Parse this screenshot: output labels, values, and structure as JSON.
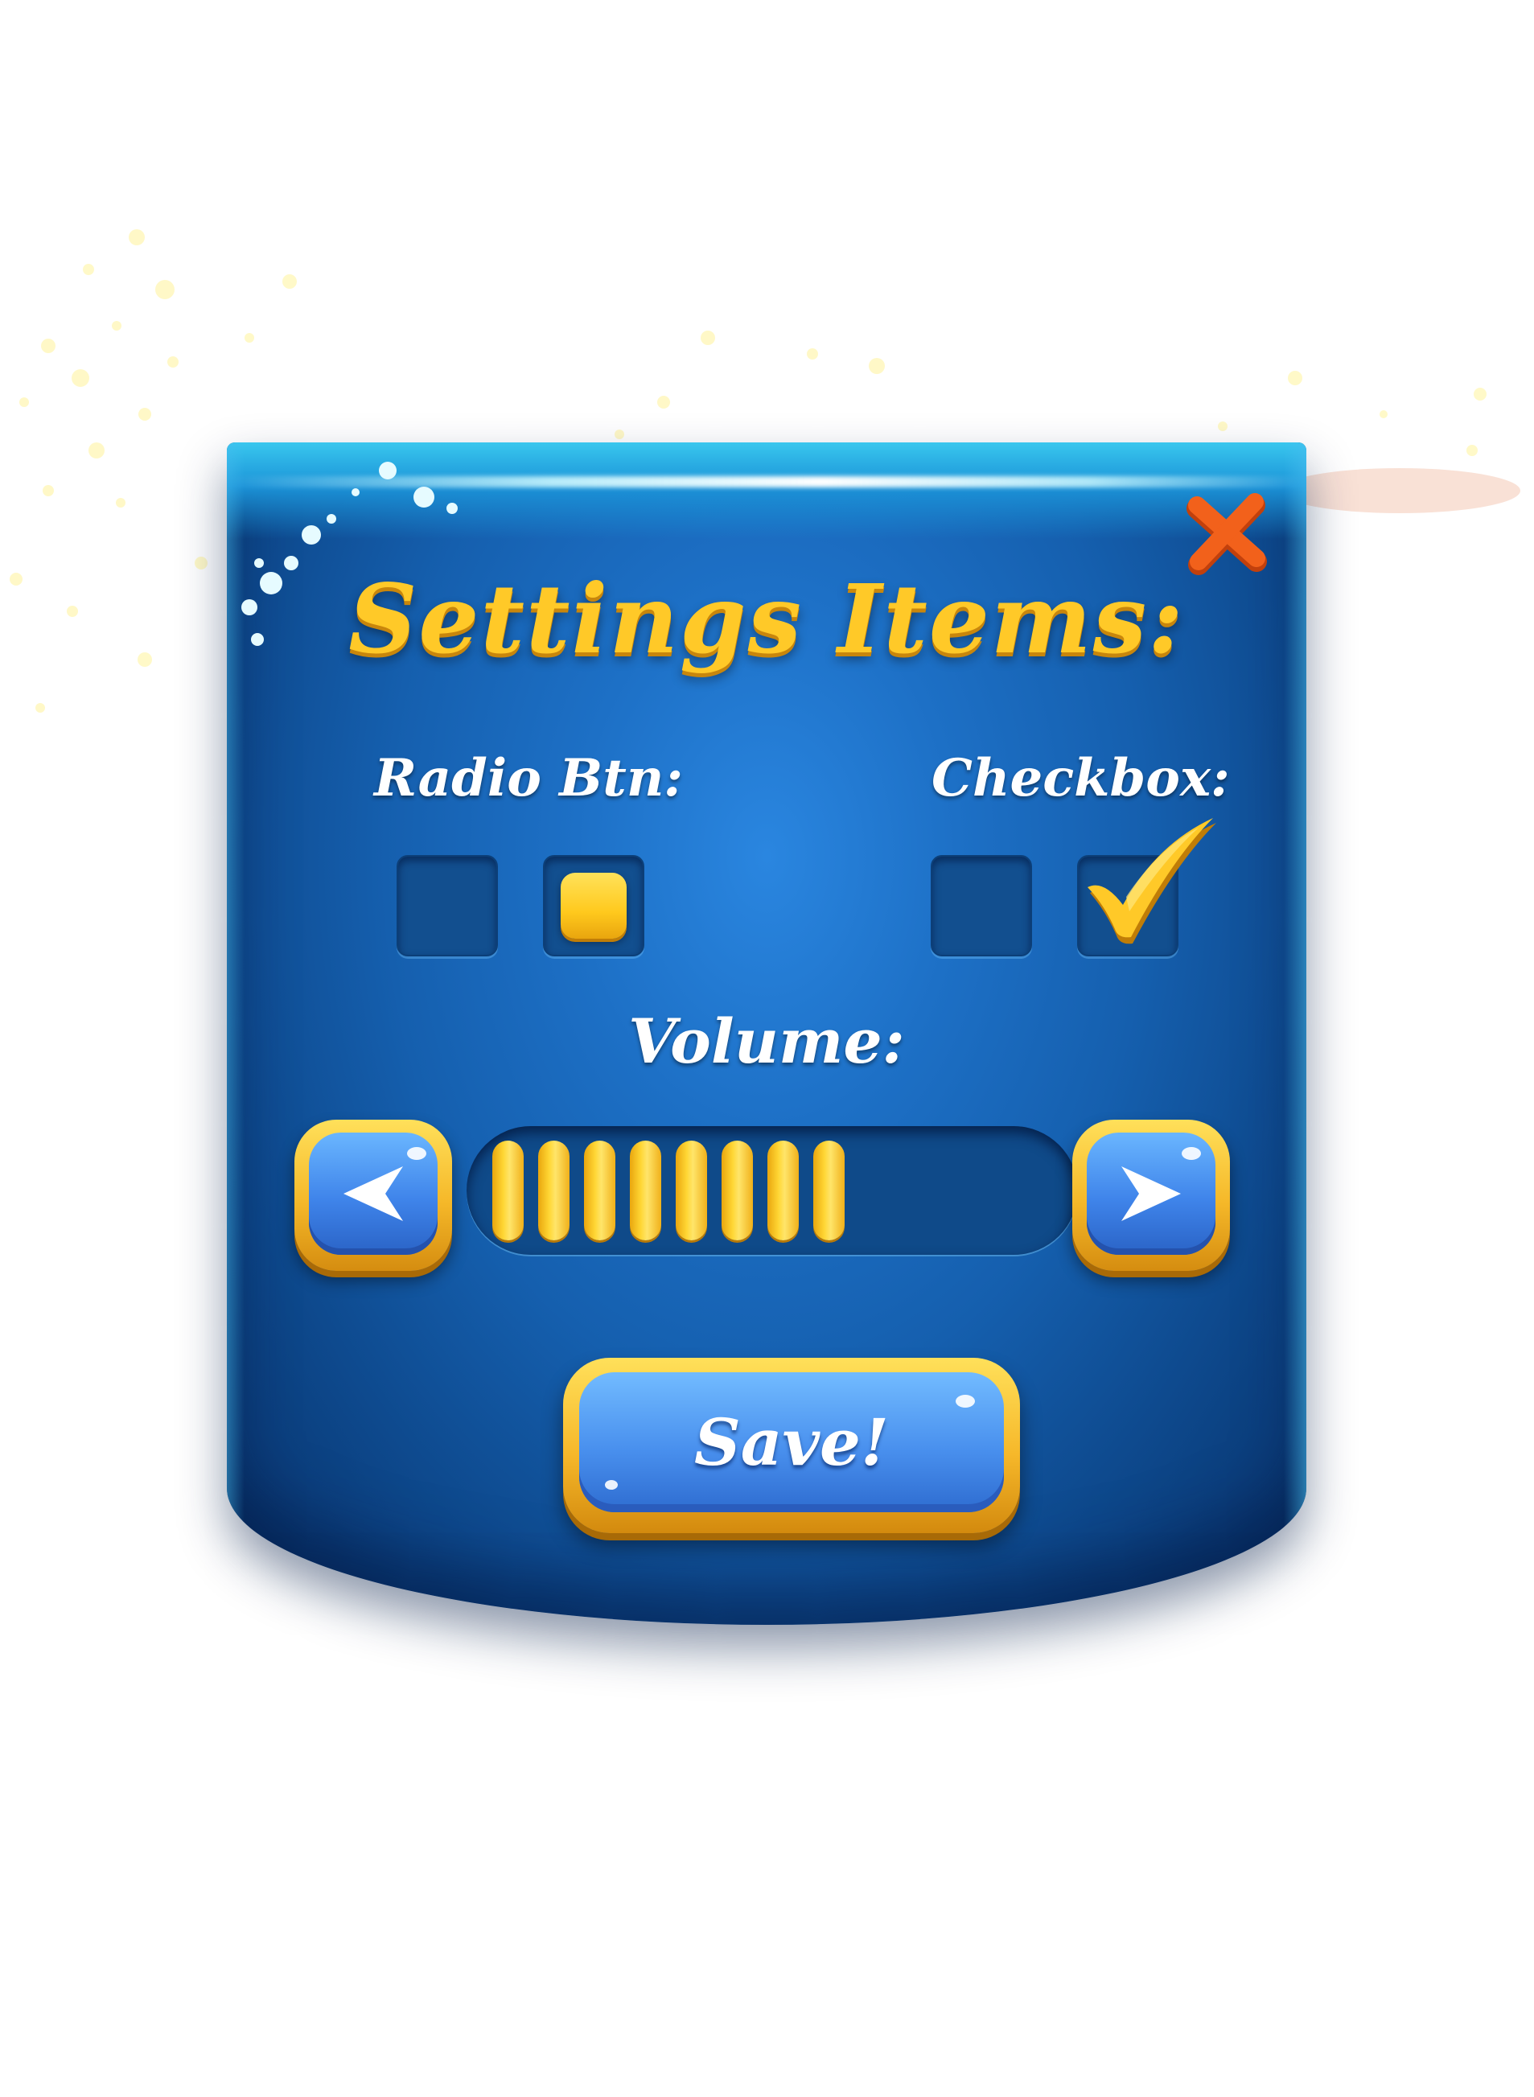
{
  "dialog": {
    "title": "Settings Items:",
    "close_icon": "close-x-icon"
  },
  "radio": {
    "label": "Radio Btn:",
    "options": [
      {
        "selected": false
      },
      {
        "selected": true
      }
    ]
  },
  "checkbox": {
    "label": "Checkbox:",
    "options": [
      {
        "checked": false
      },
      {
        "checked": true
      }
    ],
    "check_icon": "checkmark-icon"
  },
  "volume": {
    "label": "Volume:",
    "level": 8,
    "decrease_icon": "arrow-left-icon",
    "increase_icon": "arrow-right-icon"
  },
  "save_button": {
    "label": "Save!"
  },
  "colors": {
    "panel_blue": "#1d70c6",
    "accent_gold": "#ffc928",
    "close_orange": "#f2611b",
    "button_blue": "#4990ee"
  }
}
